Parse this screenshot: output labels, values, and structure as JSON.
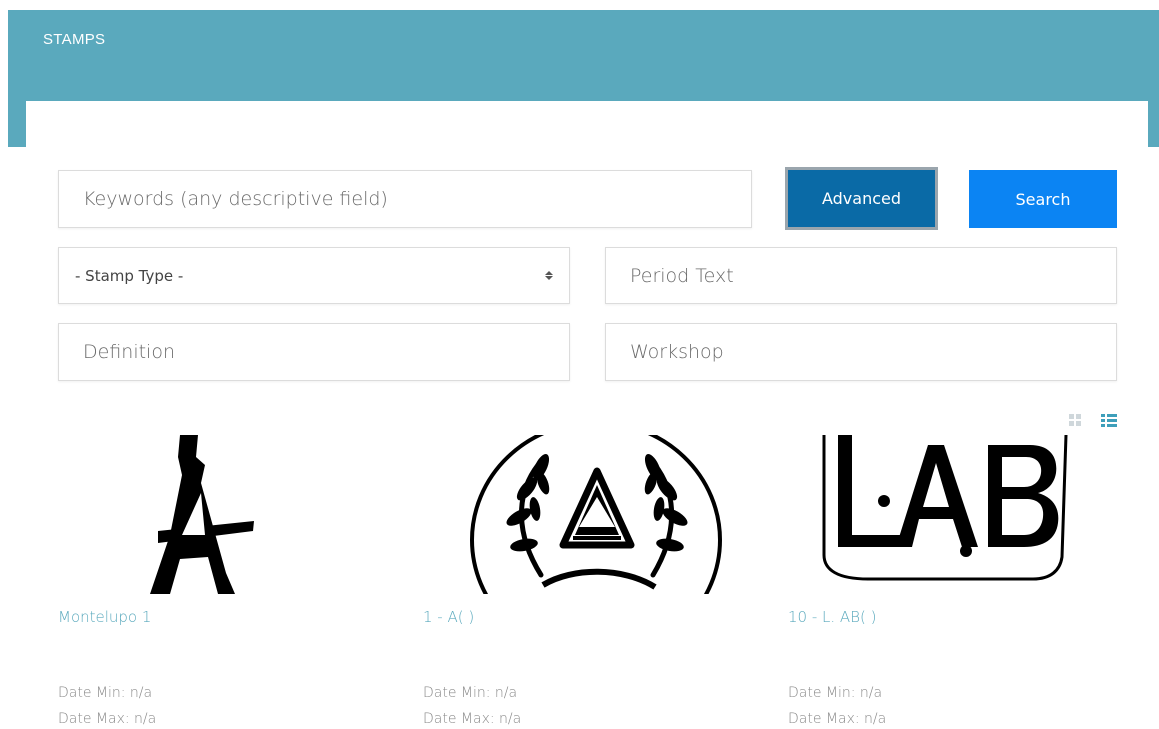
{
  "header": {
    "title": "STAMPS",
    "color": "#5aa9bd"
  },
  "search": {
    "keywords_placeholder": "Keywords (any descriptive field)",
    "advanced_label": "Advanced",
    "search_label": "Search",
    "stamp_type_selected": "- Stamp Type -",
    "period_placeholder": "Period Text",
    "definition_placeholder": "Definition",
    "workshop_placeholder": "Workshop",
    "advanced_color": "#0a6aa6",
    "search_color": "#0b84f3"
  },
  "view_toggle": {
    "grid_icon": "grid-view-icon",
    "list_icon": "list-view-icon"
  },
  "results": [
    {
      "title": "Montelupo 1",
      "date_min": "Date Min: n/a",
      "date_max": "Date Max: n/a",
      "image": "stamp-image-letter-a"
    },
    {
      "title": "1 - A( )",
      "date_min": "Date Min: n/a",
      "date_max": "Date Max: n/a",
      "image": "stamp-image-a-wreath"
    },
    {
      "title": "10 - L. AB( )",
      "date_min": "Date Min: n/a",
      "date_max": "Date Max: n/a",
      "image": "stamp-image-lab"
    }
  ]
}
